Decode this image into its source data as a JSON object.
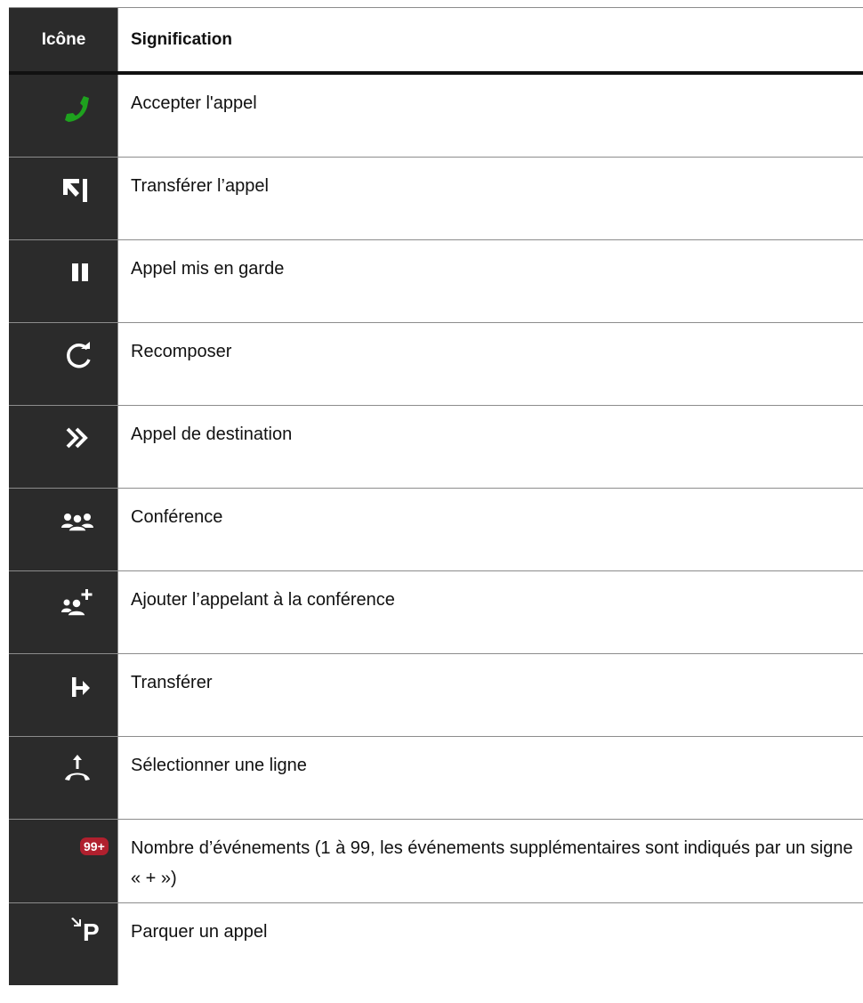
{
  "header": {
    "icon_col": "Icône",
    "meaning_col": "Signification"
  },
  "rows": [
    {
      "icon": "phone-accept-icon",
      "label": "Accepter l'appel"
    },
    {
      "icon": "transfer-call-icon",
      "label": "Transférer l’appel"
    },
    {
      "icon": "pause-icon",
      "label": "Appel mis en garde"
    },
    {
      "icon": "redial-icon",
      "label": "Recomposer"
    },
    {
      "icon": "double-chevron-icon",
      "label": "Appel de destination"
    },
    {
      "icon": "conference-icon",
      "label": "Conférence"
    },
    {
      "icon": "add-conference-icon",
      "label": "Ajouter l’appelant à la conférence"
    },
    {
      "icon": "forward-icon",
      "label": "Transférer"
    },
    {
      "icon": "select-line-icon",
      "label": "Sélectionner une ligne"
    },
    {
      "icon": "event-count-badge",
      "badge": "99+",
      "label": "Nombre d’événements (1 à 99, les événements supplémentaires sont indiqués par un signe « + »)"
    },
    {
      "icon": "park-call-icon",
      "park_letter": "P",
      "label": "Parquer un appel"
    }
  ],
  "colors": {
    "icon_column_bg": "#2b2b2b",
    "accept_green": "#1ea21e",
    "badge_red": "#b0202e"
  }
}
